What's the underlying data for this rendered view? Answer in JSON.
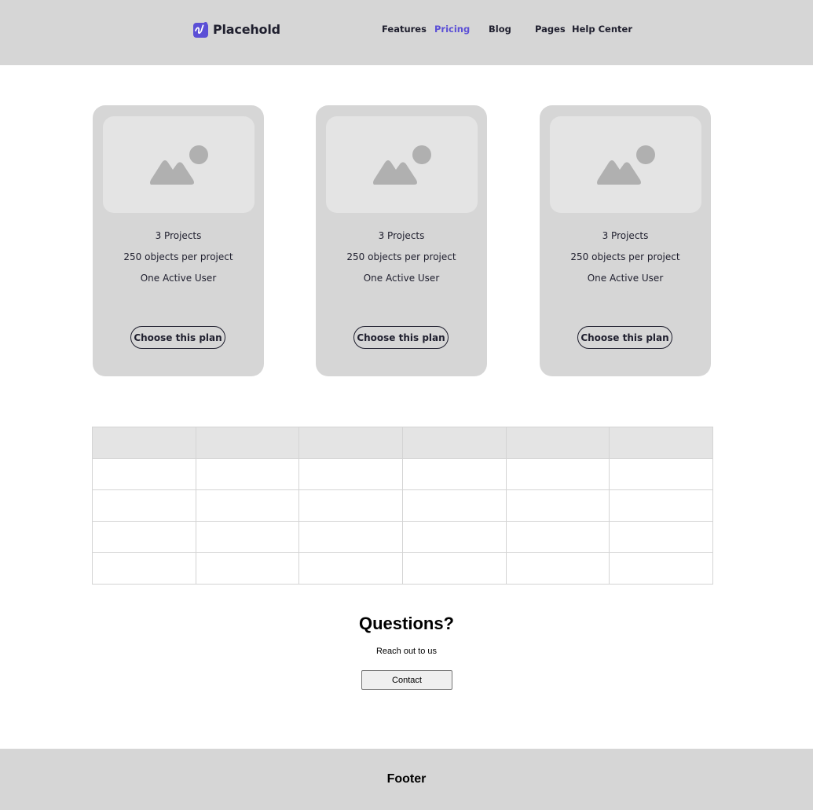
{
  "header": {
    "brand": "Placehold",
    "nav": [
      "Features",
      "Pricing",
      "Blog",
      "Pages",
      "Help Center"
    ],
    "active_nav": "Pricing",
    "accent": "#5b4fd6"
  },
  "plans": [
    {
      "features": [
        "3 Projects",
        "250 objects per project",
        "One Active User"
      ],
      "cta": "Choose this plan",
      "image": "image-placeholder-icon"
    },
    {
      "features": [
        "3 Projects",
        "250 objects per project",
        "One Active User"
      ],
      "cta": "Choose this plan",
      "image": "image-placeholder-icon"
    },
    {
      "features": [
        "3 Projects",
        "250 objects per project",
        "One Active User"
      ],
      "cta": "Choose this plan",
      "image": "image-placeholder-icon"
    }
  ],
  "questions": {
    "title": "Questions?",
    "subtitle": "Reach out to us",
    "button": "Contact"
  },
  "footer": {
    "text": "Footer"
  }
}
